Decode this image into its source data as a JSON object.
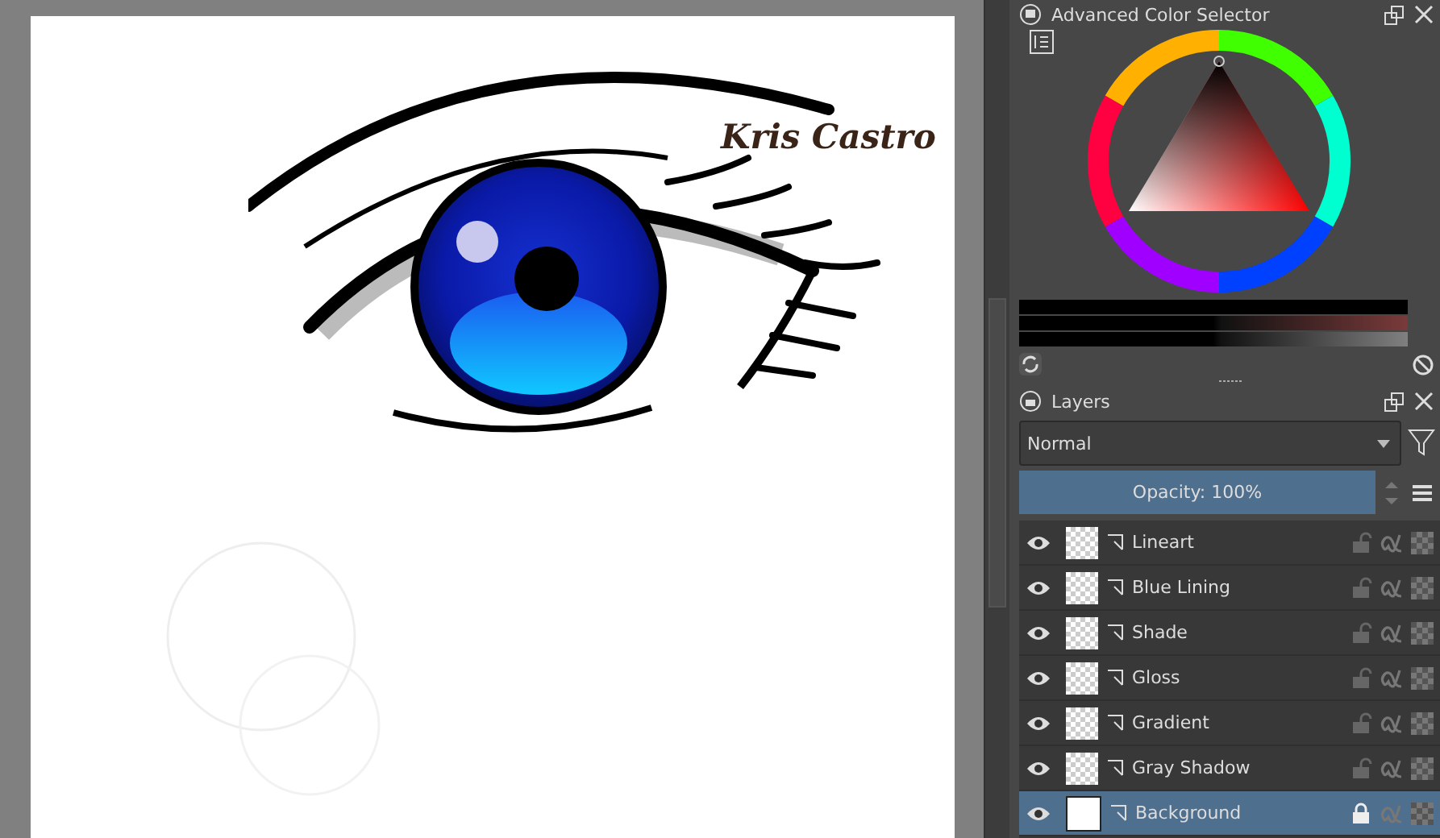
{
  "canvas": {
    "signature": "Kris Castro"
  },
  "color_selector": {
    "title": "Advanced Color Selector"
  },
  "layers_panel": {
    "title": "Layers",
    "blend_mode": "Normal",
    "opacity": {
      "label": "Opacity:  100%",
      "level": 1.0
    },
    "layers": [
      {
        "name": "Lineart",
        "kind": "transparent",
        "visible": true,
        "locked": false,
        "selected": false
      },
      {
        "name": "Blue Lining",
        "kind": "transparent",
        "visible": true,
        "locked": false,
        "selected": false
      },
      {
        "name": "Shade",
        "kind": "transparent",
        "visible": true,
        "locked": false,
        "selected": false
      },
      {
        "name": "Gloss",
        "kind": "transparent",
        "visible": true,
        "locked": false,
        "selected": false
      },
      {
        "name": "Gradient",
        "kind": "transparent",
        "visible": true,
        "locked": false,
        "selected": false
      },
      {
        "name": "Gray Shadow",
        "kind": "transparent",
        "visible": true,
        "locked": false,
        "selected": false
      },
      {
        "name": "Background",
        "kind": "filled",
        "visible": true,
        "locked": true,
        "selected": true
      }
    ]
  }
}
